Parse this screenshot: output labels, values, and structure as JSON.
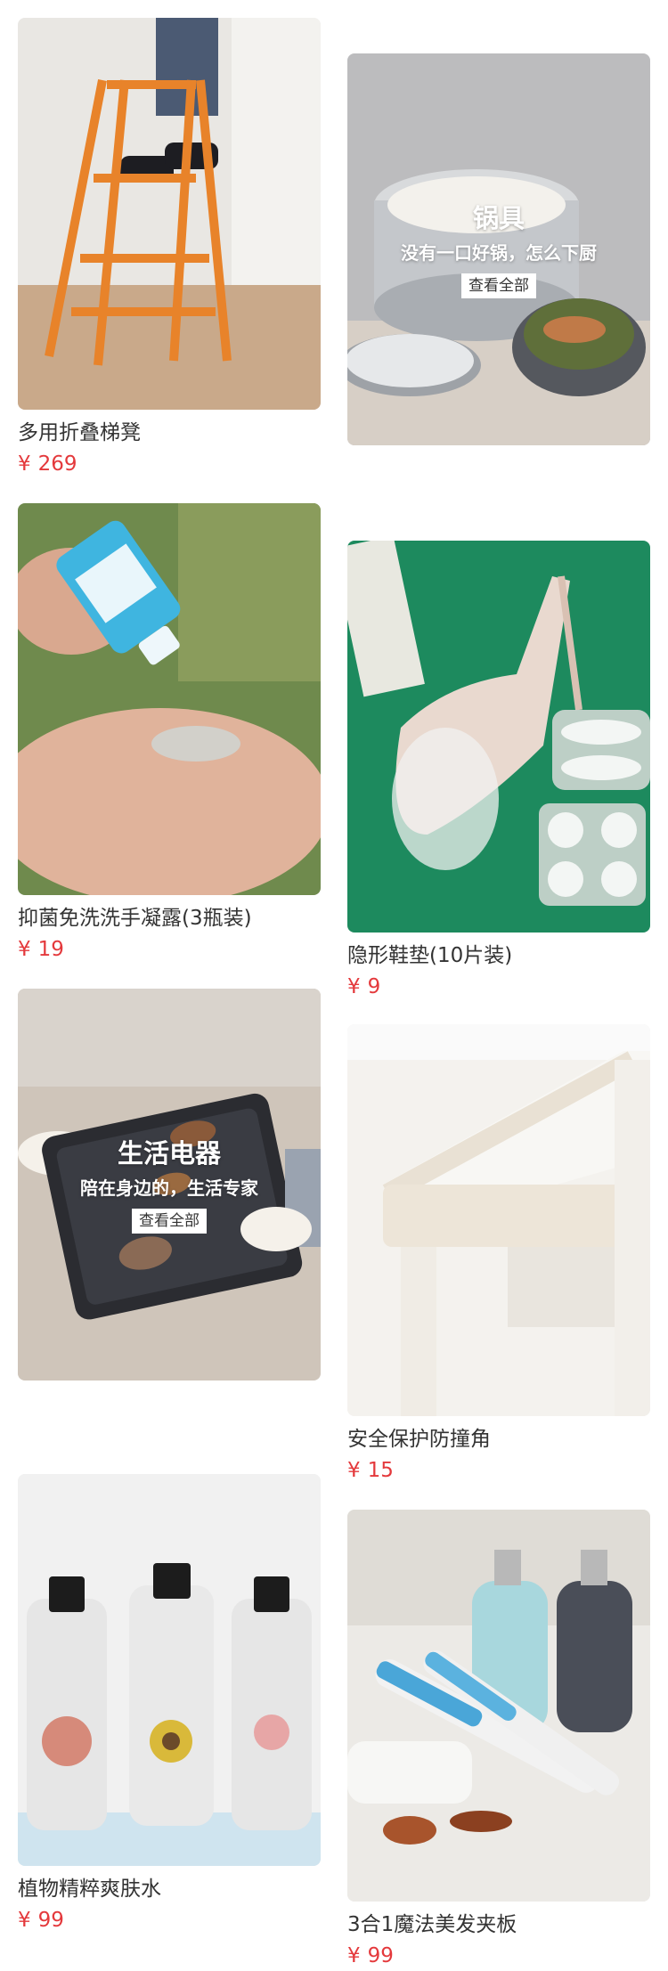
{
  "left_column": [
    {
      "type": "product",
      "title": "多用折叠梯凳",
      "currency": "¥",
      "price": "269"
    },
    {
      "type": "product",
      "title": "抑菌免洗洗手凝露(3瓶装)",
      "currency": "¥",
      "price": "19"
    },
    {
      "type": "category",
      "title": "生活电器",
      "subtitle": "陪在身边的，生活专家",
      "button": "查看全部"
    },
    {
      "type": "product",
      "title": "植物精粹爽肤水",
      "currency": "¥",
      "price": "99"
    }
  ],
  "right_column": [
    {
      "type": "category",
      "title": "锅具",
      "subtitle": "没有一口好锅，怎么下厨",
      "button": "查看全部"
    },
    {
      "type": "product",
      "title": "隐形鞋垫(10片装)",
      "currency": "¥",
      "price": "9"
    },
    {
      "type": "product",
      "title": "安全保护防撞角",
      "currency": "¥",
      "price": "15"
    },
    {
      "type": "product",
      "title": "3合1魔法美发夹板",
      "currency": "¥",
      "price": "99"
    }
  ],
  "colors": {
    "price": "#e4393c",
    "title": "#333333"
  },
  "images": [
    "ladder-photo",
    "hand-sanitizer-photo",
    "grill-photo",
    "toner-bottles-photo",
    "pot-photo",
    "shoe-insoles-photo",
    "corner-protector-photo",
    "hair-straightener-photo"
  ]
}
